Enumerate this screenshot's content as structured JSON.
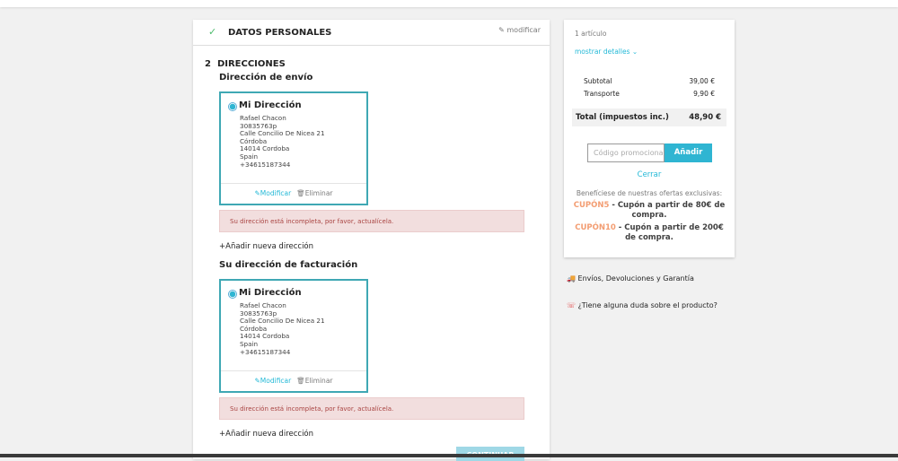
{
  "personal": {
    "title": "DATOS PERSONALES",
    "edit": "modificar"
  },
  "addresses": {
    "step": "2",
    "title": "DIRECCIONES",
    "shipping_title": "Dirección de envío",
    "billing_title": "Su dirección de facturación",
    "cards": [
      {
        "alias": "Mi Dirección",
        "lines": [
          "Rafael Chacon",
          "30835763p",
          "Calle Concilio De Nicea 21",
          "Córdoba",
          "14014 Cordoba",
          "Spain",
          "+34615187344"
        ],
        "edit": "Modificar",
        "delete": "Eliminar",
        "alert": "Su dirección está incompleta, por favor, actualícela.",
        "add": "Añadir nueva dirección"
      },
      {
        "alias": "Mi Dirección",
        "lines": [
          "Rafael Chacon",
          "30835763p",
          "Calle Concilio De Nicea 21",
          "Córdoba",
          "14014 Cordoba",
          "Spain",
          "+34615187344"
        ],
        "edit": "Modificar",
        "delete": "Eliminar",
        "alert": "Su dirección está incompleta, por favor, actualícela.",
        "add": "Añadir nueva dirección"
      }
    ],
    "continue": "CONTINUAR"
  },
  "summary": {
    "items": "1 artículo",
    "details": "mostrar detalles",
    "subtotal_label": "Subtotal",
    "subtotal": "39,00 €",
    "shipping_label": "Transporte",
    "shipping": "9,90 €",
    "total_label": "Total (impuestos inc.)",
    "total": "48,90 €",
    "promo_placeholder": "Código promocional",
    "add": "Añadir",
    "close": "Cerrar",
    "offers": "Benefíciese de nuestras ofertas exclusivas:",
    "coupons": [
      {
        "code": "CUPÓN5",
        "text": " - Cupón a partir de 80€ de compra."
      },
      {
        "code": "CUPÓN10",
        "text": " - Cupón a partir de 200€ de compra."
      }
    ]
  },
  "reassurance": [
    {
      "icon": "shipping-icon",
      "text": "Envíos, Devoluciones y Garantía"
    },
    {
      "icon": "support-icon",
      "text": "¿Tiene alguna duda sobre el producto?"
    }
  ],
  "colors": {
    "accent": "#2fb5d2",
    "alert_bg": "#f2dede",
    "coupon": "#f39d72"
  }
}
